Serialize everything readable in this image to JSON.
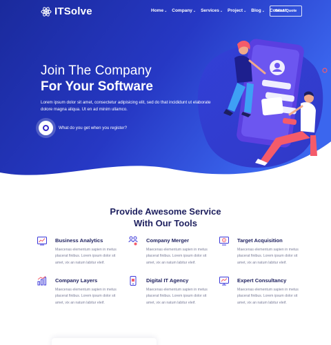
{
  "brand": {
    "name": "ITSolve",
    "icon": "atom-icon"
  },
  "nav": {
    "items": [
      {
        "label": "Home",
        "dropdown": true
      },
      {
        "label": "Company",
        "dropdown": true
      },
      {
        "label": "Services",
        "dropdown": true
      },
      {
        "label": "Project",
        "dropdown": true
      },
      {
        "label": "Blog",
        "dropdown": true
      },
      {
        "label": "Contact",
        "dropdown": false
      }
    ],
    "cta": "Get A Quote"
  },
  "hero": {
    "title_line1": "Join The Company",
    "title_line2": "For Your Software",
    "description": "Lorem ipsum dolor sit amet, consectetur adipisicing elit, sed do that incididunt ut elaborate dolore magna aliqua. Ut en ad minim ullamco.",
    "video_label": "What do you get when you register?"
  },
  "services": {
    "heading_line1": "Provide Awesome Service",
    "heading_line2": "With Our Tools",
    "items": [
      {
        "title": "Business Analytics",
        "icon": "analytics-chart-icon",
        "text": "Maecenas elementum sapien in metus placerat finibus. Lorem ipsum dolor sit amet, vix an natum labitur eleif."
      },
      {
        "title": "Company Merger",
        "icon": "merger-people-icon",
        "text": "Maecenas elementum sapien in metus placerat finibus. Lorem ipsum dolor sit amet, vix an natum labitur eleif."
      },
      {
        "title": "Target Acquisition",
        "icon": "target-monitor-icon",
        "text": "Maecenas elementum sapien in metus placerat finibus. Lorem ipsum dolor sit amet, vix an natum labitur eleif."
      },
      {
        "title": "Company Layers",
        "icon": "layers-bar-chart-icon",
        "text": "Maecenas elementum sapien in metus placerat finibus. Lorem ipsum dolor sit amet, vix an natum labitur eleif."
      },
      {
        "title": "Digital IT Agency",
        "icon": "digital-phone-icon",
        "text": "Maecenas elementum sapien in metus placerat finibus. Lorem ipsum dolor sit amet, vix an natum labitur eleif."
      },
      {
        "title": "Expert Consultancy",
        "icon": "consultancy-screen-icon",
        "text": "Maecenas elementum sapien in metus placerat finibus. Lorem ipsum dolor sit amet, vix an natum labitur eleif."
      }
    ]
  },
  "colors": {
    "primary_dark": "#1e2ba0",
    "primary": "#3a36d8",
    "accent": "#f45b6a",
    "heading": "#1d1f5e",
    "body_text": "#7a7d99"
  }
}
